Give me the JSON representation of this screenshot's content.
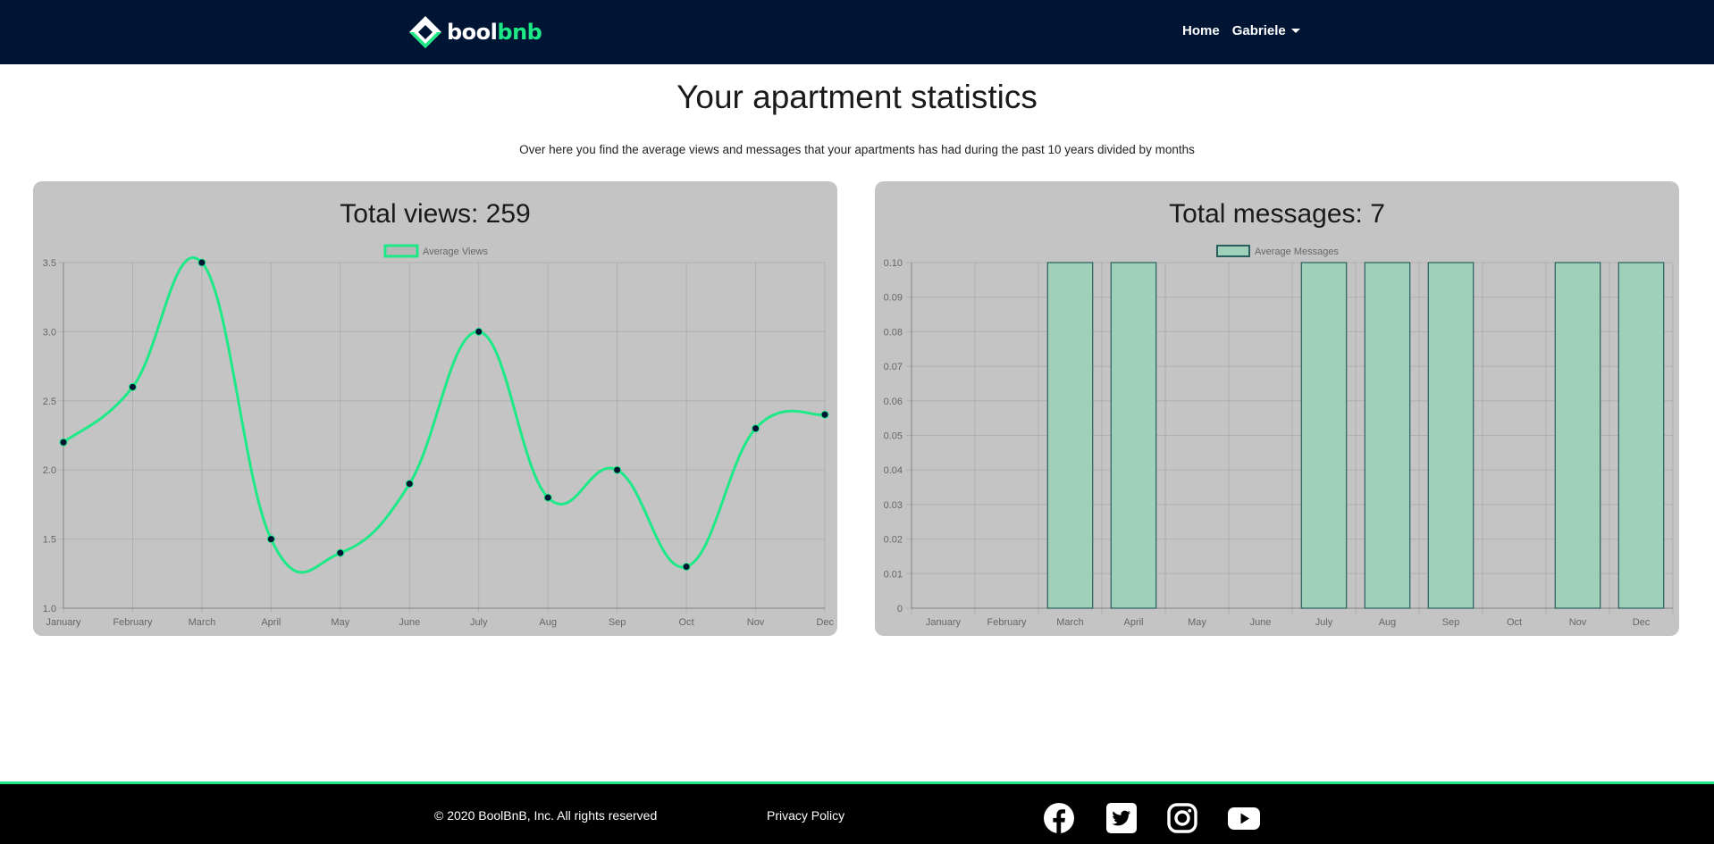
{
  "nav": {
    "brand_part1": "bool",
    "brand_part2": "bnb",
    "home": "Home",
    "user": "Gabriele"
  },
  "page": {
    "title": "Your apartment statistics",
    "subtitle": "Over here you find the average views and messages that your apartments has had during the past 10 years divided by months"
  },
  "views_card": {
    "title": "Total views: 259"
  },
  "messages_card": {
    "title": "Total messages: 7"
  },
  "chart_data": [
    {
      "type": "line",
      "legend": "Average Views",
      "legend_position": "top",
      "grid": true,
      "line_color": "#1de987",
      "point_color": "#001434",
      "categories": [
        "January",
        "February",
        "March",
        "April",
        "May",
        "June",
        "July",
        "Aug",
        "Sep",
        "Oct",
        "Nov",
        "Dec"
      ],
      "values": [
        2.2,
        2.6,
        3.5,
        1.5,
        1.4,
        1.9,
        3.0,
        1.8,
        2.0,
        1.3,
        2.3,
        2.4
      ],
      "ylim": [
        1.0,
        3.5
      ],
      "yticks": [
        "1.0",
        "1.5",
        "2.0",
        "2.5",
        "3.0",
        "3.5"
      ]
    },
    {
      "type": "bar",
      "legend": "Average Messages",
      "legend_position": "top",
      "grid": true,
      "bar_color": "#9ed0ba",
      "bar_border": "#2a5f5f",
      "categories": [
        "January",
        "February",
        "March",
        "April",
        "May",
        "June",
        "July",
        "Aug",
        "Sep",
        "Oct",
        "Nov",
        "Dec"
      ],
      "values": [
        0,
        0,
        0.1,
        0.1,
        0,
        0,
        0.1,
        0.1,
        0.1,
        0,
        0.1,
        0.1
      ],
      "ylim": [
        0,
        0.1
      ],
      "yticks": [
        "0",
        "0.01",
        "0.02",
        "0.03",
        "0.04",
        "0.05",
        "0.06",
        "0.07",
        "0.08",
        "0.09",
        "0.10"
      ]
    }
  ],
  "footer": {
    "copyright": "© 2020 BoolBnB, Inc. All rights reserved",
    "privacy": "Privacy Policy"
  }
}
